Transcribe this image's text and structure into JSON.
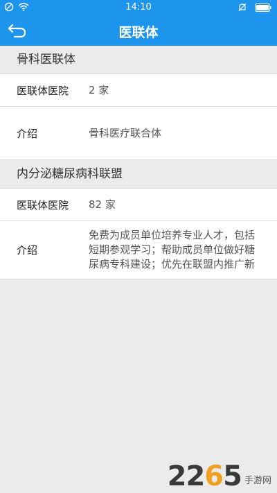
{
  "status_bar": {
    "time": "14:10"
  },
  "nav": {
    "title": "医联体"
  },
  "sections": [
    {
      "header": "骨科医联体",
      "hospitals_label": "医联体医院",
      "hospitals_value": "2 家",
      "intro_label": "介绍",
      "intro_value": "骨科医疗联合体"
    },
    {
      "header": "内分泌糖尿病科联盟",
      "hospitals_label": "医联体医院",
      "hospitals_value": "82 家",
      "intro_label": "介绍",
      "intro_value": "免费为成员单位培养专业人才，包括短期参观学习；帮助成员单位做好糖尿病专科建设；优先在联盟内推广新"
    }
  ],
  "watermark": {
    "digits_a": "22",
    "digits_b": "6",
    "digits_c": "5",
    "suffix": "手游网"
  }
}
